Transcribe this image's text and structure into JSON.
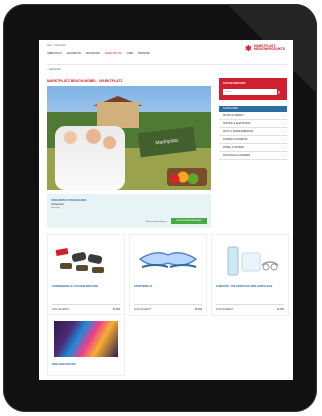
{
  "breadcrumb": "Start · Marktplatz",
  "nav": {
    "items": [
      "ÜBERSICHT",
      "ANGEBOTE",
      "ANFRAGEN",
      "MARKTPLATZ",
      "JOBS",
      "TERMINE"
    ],
    "active_index": 3
  },
  "logo": {
    "mark": "✱",
    "text_line1": "MARKTPLATZ",
    "text_line2": "MEDIZINPRODUKTE"
  },
  "home_link": "⌂ Marktplatz",
  "page_title": "MARKTPLATZ BRUCH-MÖBEL · MARKTPLATZ",
  "hero": {
    "sign_text": "Marktplatz"
  },
  "info": {
    "title": "VERANSTALTUNGEN 2024",
    "subtitle": "Trödelmarkt",
    "subtitle2": "Samstag",
    "link_text": "Weitere Informationen",
    "button_label": "Zu den Veranstaltungen"
  },
  "products": [
    {
      "name": "SONNENBRILLE AUS DEM BESTAND",
      "link": "ZUM ANGEBOT",
      "price": "25,00€"
    },
    {
      "name": "SPORTBRILLE",
      "link": "ZUM ANGEBOT",
      "price": "35,00€"
    },
    {
      "name": "ZUBEHÖR · DIE PERFEKTE BRILLENPFLEGE",
      "link": "ZUM ANGEBOT",
      "price": "19,00€"
    }
  ],
  "product_bottom": {
    "name": "BRILLENFASSUNG"
  },
  "sidebar": {
    "title": "SUCHFUNKTION",
    "search_placeholder": "Suche",
    "search_icon": "magnifier-icon",
    "category_header": "KATEGORIE",
    "categories": [
      "SPORT & FREIZEIT",
      "TECHNIK & ELEKTRONIK",
      "ANTIK & SAMMLERBEDARF",
      "FAHRZEUG ZUBEHÖR",
      "MÖBEL & WOHNEN",
      "SONSTIGES & ANDERES"
    ]
  },
  "colors": {
    "brand_red": "#d0202f",
    "link_blue": "#2b6ea3",
    "button_green": "#4aa846"
  }
}
